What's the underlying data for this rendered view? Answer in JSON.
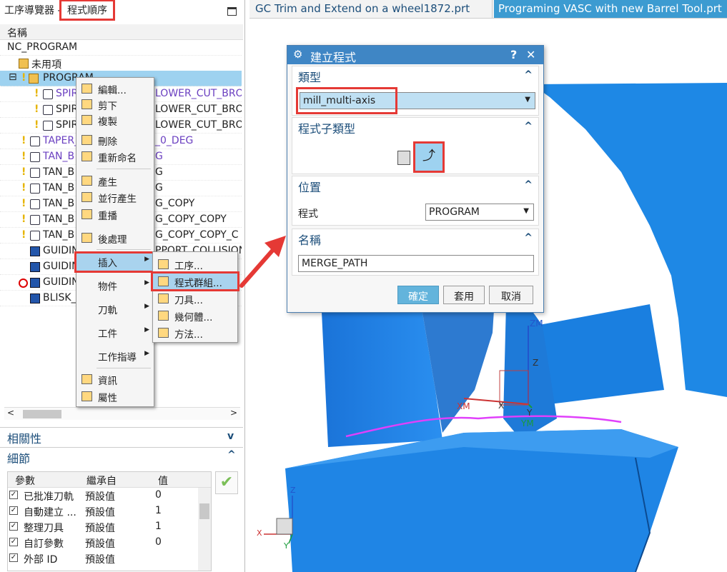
{
  "nav": {
    "title": "工序導覽器 - ",
    "view": "程式順序",
    "column_name": "名稱",
    "rows": [
      {
        "label": "NC_PROGRAM"
      },
      {
        "label": "未用項"
      },
      {
        "label": "PROGRAM"
      },
      {
        "label": "SPIR"
      },
      {
        "label": "LOWER_CUT_BRO"
      },
      {
        "label": "SPIR"
      },
      {
        "label": "LOWER_CUT_BRO"
      },
      {
        "label": "SPIR"
      },
      {
        "label": "LOWER_CUT_BRO"
      },
      {
        "label": "TAPER_"
      },
      {
        "label": "_0_DEG"
      },
      {
        "label": "TAN_B"
      },
      {
        "label": "G"
      },
      {
        "label": "TAN_B"
      },
      {
        "label": "G"
      },
      {
        "label": "TAN_B"
      },
      {
        "label": "G"
      },
      {
        "label": "TAN_B"
      },
      {
        "label": "G_COPY"
      },
      {
        "label": "TAN_B"
      },
      {
        "label": "G_COPY_COPY"
      },
      {
        "label": "TAN_B"
      },
      {
        "label": "G_COPY_COPY_C"
      },
      {
        "label": "GUIDIN"
      },
      {
        "label": "PPORT_COLLISION"
      },
      {
        "label": "GUIDIN"
      },
      {
        "label": "GUIDIN"
      },
      {
        "label": "BLISK_"
      }
    ]
  },
  "panels": {
    "related": "相關性",
    "details": "細節"
  },
  "details_table": {
    "headers": [
      "參數",
      "繼承自",
      "值"
    ],
    "rows": [
      {
        "param": "已批准刀軌",
        "from": "預設值",
        "value": "0"
      },
      {
        "param": "自動建立 ...",
        "from": "預設值",
        "value": "1"
      },
      {
        "param": "整理刀具",
        "from": "預設值",
        "value": "1"
      },
      {
        "param": "自訂參數",
        "from": "預設值",
        "value": "0"
      },
      {
        "param": "外部 ID",
        "from": "預設值",
        "value": ""
      }
    ]
  },
  "context_menu": {
    "items": [
      "編輯...",
      "剪下",
      "複製",
      "刪除",
      "重新命名",
      "產生",
      "並行產生",
      "重播",
      "後處理",
      "插入",
      "物件",
      "刀軌",
      "工件",
      "工作指導",
      "資訊",
      "屬性"
    ]
  },
  "submenu": {
    "items": [
      "工序...",
      "程式群組...",
      "刀具...",
      "幾何體...",
      "方法..."
    ]
  },
  "tabs": [
    {
      "label": "GC Trim and Extend on a wheel1872.prt"
    },
    {
      "label": "Programing VASC with new Barrel Tool.prt"
    }
  ],
  "dialog": {
    "title": "建立程式",
    "help": "?",
    "close": "✕",
    "type_section": "類型",
    "type_value": "mill_multi-axis",
    "subtype_section": "程式子類型",
    "location_section": "位置",
    "program_label": "程式",
    "program_value": "PROGRAM",
    "name_section": "名稱",
    "name_value": "MERGE_PATH",
    "ok": "確定",
    "apply": "套用",
    "cancel": "取消"
  },
  "axes": {
    "zm": "ZM",
    "z": "Z",
    "xm": "XM",
    "x": "X",
    "y": "Y",
    "ym": "YM",
    "tx": "X",
    "tz": "Z",
    "ty": "Y"
  },
  "colors": {
    "accent": "#3f86c5",
    "highlight_selected": "#9ed2f0",
    "part_blue": "#1e88e5",
    "annotation_red": "#e53935"
  }
}
